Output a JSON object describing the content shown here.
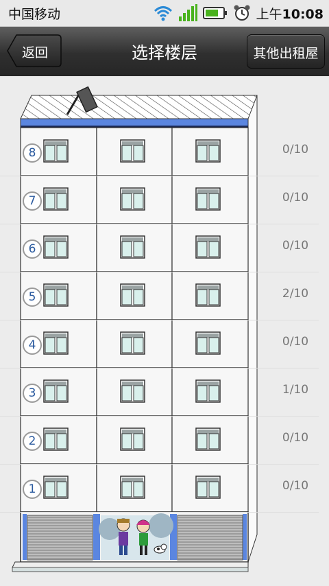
{
  "status_bar": {
    "carrier": "中国移动",
    "time_prefix": "上午",
    "time": "10:08",
    "icons": [
      "wifi-icon",
      "signal-icon",
      "battery-icon",
      "alarm-icon"
    ]
  },
  "header": {
    "back_label": "返回",
    "title": "选择楼层",
    "other_label": "其他出租屋"
  },
  "floors": [
    {
      "number": "8",
      "occupancy": "0/10"
    },
    {
      "number": "7",
      "occupancy": "0/10"
    },
    {
      "number": "6",
      "occupancy": "0/10"
    },
    {
      "number": "5",
      "occupancy": "2/10"
    },
    {
      "number": "4",
      "occupancy": "0/10"
    },
    {
      "number": "3",
      "occupancy": "1/10"
    },
    {
      "number": "2",
      "occupancy": "0/10"
    },
    {
      "number": "1",
      "occupancy": "0/10"
    }
  ],
  "colors": {
    "titlebar": "#2f2f2f",
    "roof_stripe": "#5b86e0",
    "badge_text": "#2a5a9f",
    "count_text": "#777777"
  }
}
